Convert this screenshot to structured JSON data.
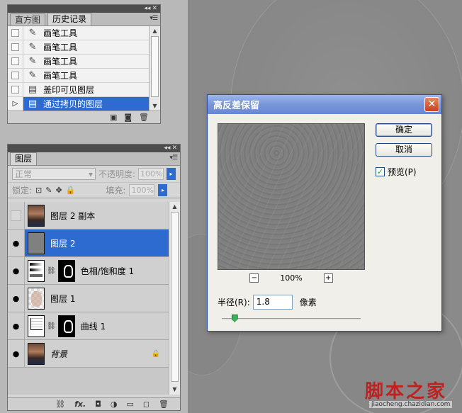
{
  "history_panel": {
    "tabs": [
      "直方图",
      "历史记录"
    ],
    "collapse_glyph": "◂◂",
    "close_glyph": "✕",
    "menu_glyph": "▾☰",
    "items": [
      {
        "label": "画笔工具",
        "icon": "brush-icon"
      },
      {
        "label": "画笔工具",
        "icon": "brush-icon"
      },
      {
        "label": "画笔工具",
        "icon": "brush-icon"
      },
      {
        "label": "画笔工具",
        "icon": "brush-icon"
      },
      {
        "label": "盖印可见图层",
        "icon": "document-icon"
      },
      {
        "label": "通过拷贝的图层",
        "icon": "document-icon",
        "selected": true
      }
    ]
  },
  "layers_panel": {
    "tab": "图层",
    "blend_mode": "正常",
    "opacity_label": "不透明度:",
    "opacity_value": "100%",
    "lock_label": "锁定:",
    "fill_label": "填充:",
    "fill_value": "100%",
    "layers": [
      {
        "name": "图层 2 副本",
        "visible": false,
        "thumb": "photo"
      },
      {
        "name": "图层 2",
        "visible": true,
        "thumb": "gray",
        "selected": true
      },
      {
        "name": "色相/饱和度 1",
        "visible": true,
        "thumb": "adjustment",
        "mask": true
      },
      {
        "name": "图层 1",
        "visible": true,
        "thumb": "transparent"
      },
      {
        "name": "曲线 1",
        "visible": true,
        "thumb": "curves",
        "mask": true
      },
      {
        "name": "背景",
        "visible": true,
        "thumb": "photo",
        "locked": true
      }
    ],
    "footer_icons": [
      "link-icon",
      "fx-icon",
      "mask-icon",
      "adjustment-icon",
      "folder-icon",
      "new-layer-icon",
      "trash-icon"
    ]
  },
  "dialog": {
    "title": "高反差保留",
    "ok_label": "确定",
    "cancel_label": "取消",
    "preview_label": "预览(P)",
    "preview_checked": true,
    "zoom": "100%",
    "radius_label": "半径(R):",
    "radius_value": "1.8",
    "radius_unit": "像素",
    "slider_fraction": 0.09
  },
  "watermark": {
    "text": "脚本之家",
    "url": "jiaocheng.chazidian.com"
  },
  "colors": {
    "selection": "#2e6bd1",
    "dialog_title": "#7795d9",
    "close_button": "#c5411c"
  }
}
